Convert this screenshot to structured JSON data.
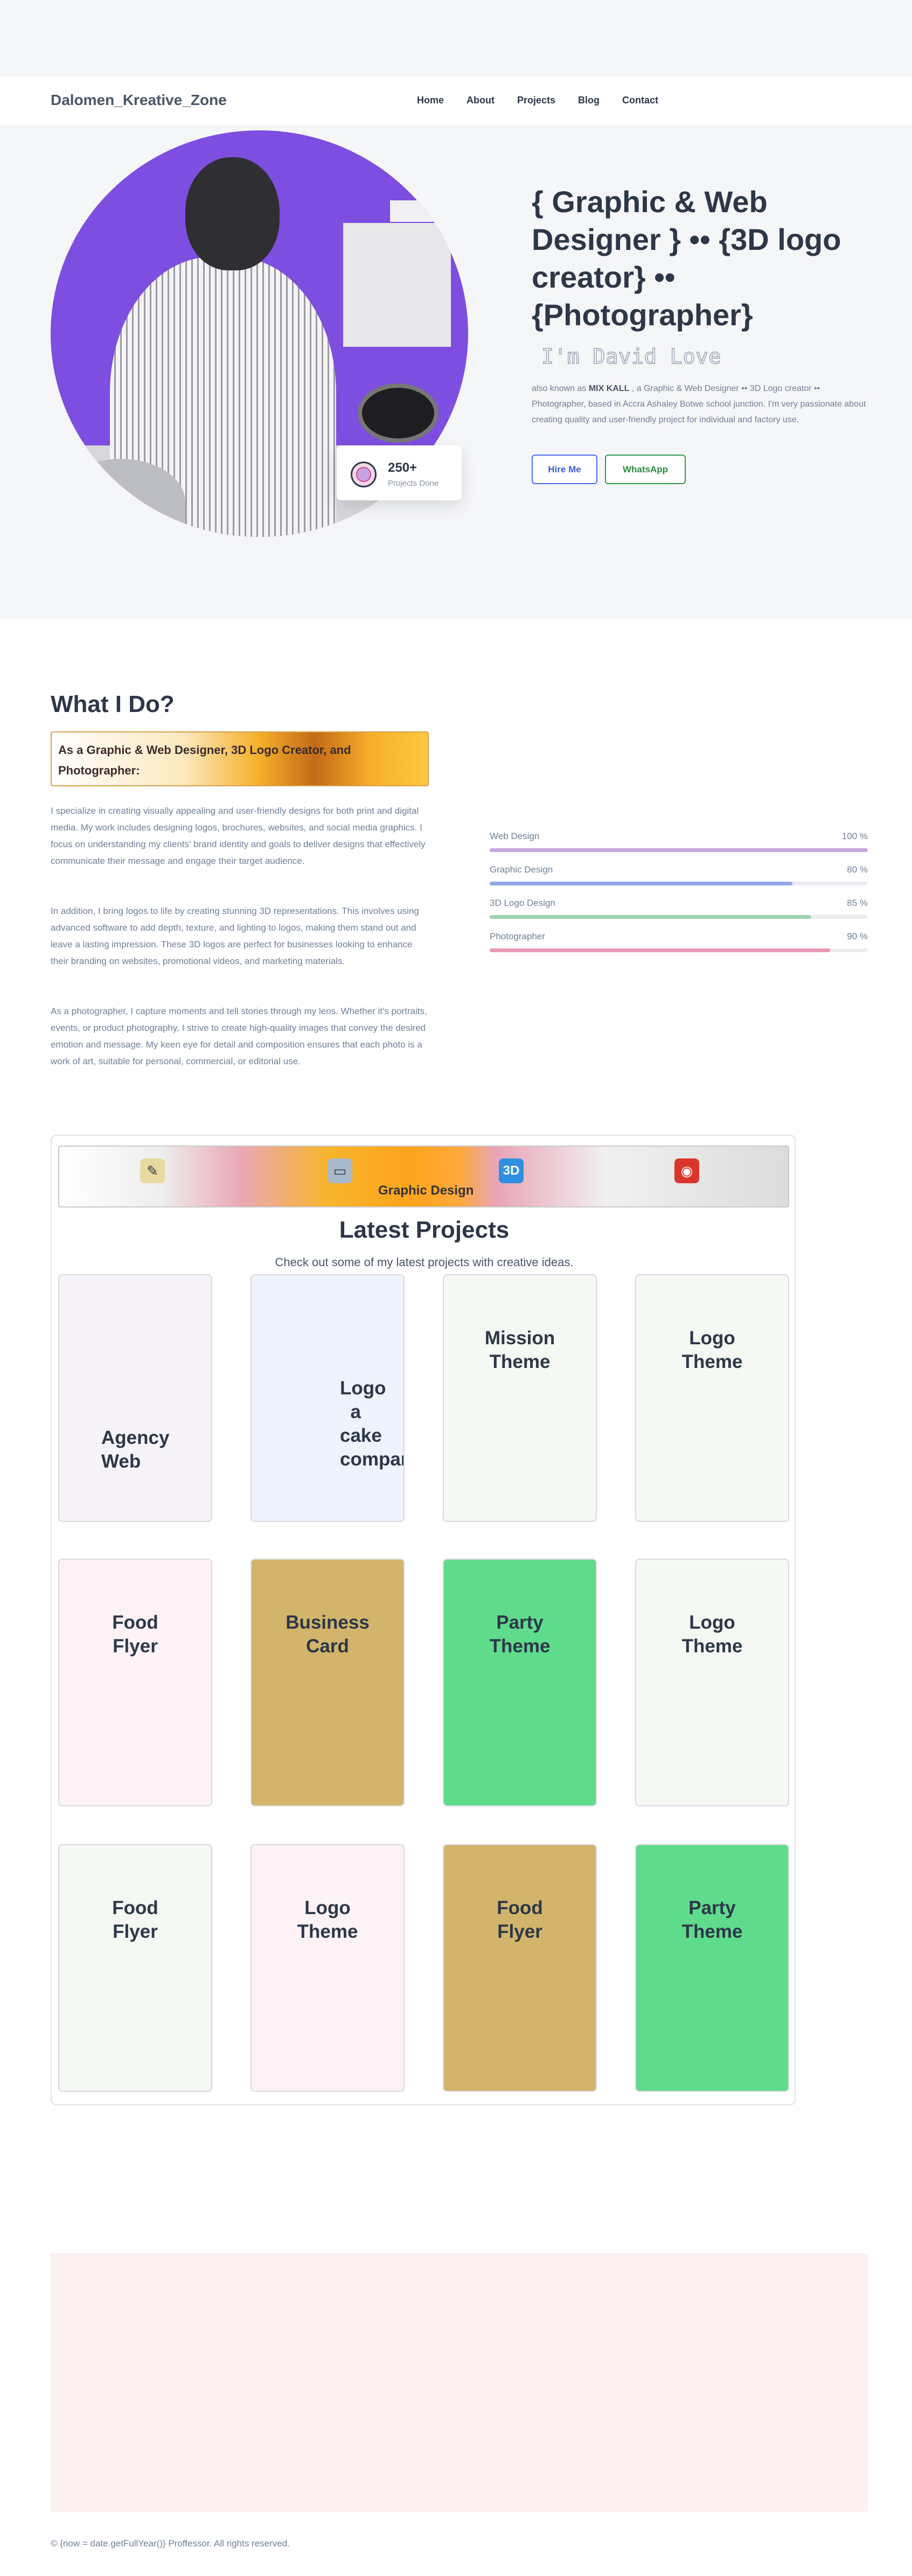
{
  "header": {
    "brand": "Dalomen_Kreative_Zone",
    "nav": [
      "Home",
      "About",
      "Projects",
      "Blog",
      "Contact"
    ]
  },
  "hero": {
    "title": "{ Graphic & Web Designer } •• {3D logo creator} •• {Photographer}",
    "name_line": "I'm David Love",
    "desc_prefix": "also known as ",
    "desc_bold": "MIX KALL",
    "desc_rest": " , a Graphic & Web Designer •• 3D Logo creator •• Photographer, based in Accra Ashaley Botwe school junction. I'm very passionate about creating quality and user-friendly project for individual and factory use.",
    "stat_number": "250+",
    "stat_label": "Projects Done",
    "hire_label": "Hire Me",
    "whatsapp_label": "WhatsApp"
  },
  "what": {
    "title": "What I Do?",
    "banner": "As a Graphic & Web Designer, 3D Logo Creator, and Photographer:",
    "paragraphs": [
      "I specialize in creating visually appealing and user-friendly designs for both print and digital media. My work includes designing logos, brochures, websites, and social media graphics. I focus on understanding my clients' brand identity and goals to deliver designs that effectively communicate their message and engage their target audience.",
      "In addition, I bring logos to life by creating stunning 3D representations. This involves using advanced software to add depth, texture, and lighting to logos, making them stand out and leave a lasting impression. These 3D logos are perfect for businesses looking to enhance their branding on websites, promotional videos, and marketing materials.",
      "As a photographer, I capture moments and tell stories through my lens. Whether it's portraits, events, or product photography, I strive to create high-quality images that convey the desired emotion and message. My keen eye for detail and composition ensures that each photo is a work of art, suitable for personal, commercial, or editorial use."
    ],
    "skills": [
      {
        "label": "Web Design",
        "value": "100 %",
        "pct": 100,
        "color": "#c7a6dd"
      },
      {
        "label": "Graphic Design",
        "value": "80 %",
        "pct": 80,
        "color": "#8fa8e6"
      },
      {
        "label": "3D Logo Design",
        "value": "85 %",
        "pct": 85,
        "color": "#9fd2b0"
      },
      {
        "label": "Photographer",
        "value": "90 %",
        "pct": 90,
        "color": "#e89ab3"
      }
    ]
  },
  "projects": {
    "ribbon_label": "Graphic Design",
    "ribbon_icons": [
      "pen-tablet-icon",
      "laptop-icon",
      "3d-icon",
      "camera-icon"
    ],
    "title": "Latest Projects",
    "subtitle": "Check out some of my latest projects with creative ideas.",
    "cards": [
      {
        "title": "Agency\nWeb",
        "bg": "#f6f4f9"
      },
      {
        "title": "Logo\n  a\ncake\ncompany",
        "bg": "#eef3fc"
      },
      {
        "title": "Mission\nTheme",
        "bg": "#f5f8f3"
      },
      {
        "title": "Logo\nTheme",
        "bg": "#f5f8f3"
      },
      {
        "title": "Food\nFlyer",
        "bg": "#fdf3f6"
      },
      {
        "title": "Business\nCard",
        "bg": "#d2b56a"
      },
      {
        "title": "Party\nTheme",
        "bg": "#5fdb8c"
      },
      {
        "title": "Logo\nTheme",
        "bg": "#f5f8f3"
      },
      {
        "title": "Food\nFlyer",
        "bg": "#f5f8f3"
      },
      {
        "title": "Logo\nTheme",
        "bg": "#fdf3f6"
      },
      {
        "title": "Food\nFlyer",
        "bg": "#d2b56a"
      },
      {
        "title": "Party\nTheme",
        "bg": "#5fdb8c"
      }
    ]
  },
  "footer": {
    "text": "© {now = date.getFullYear()} Proffessor. All rights reserved."
  }
}
